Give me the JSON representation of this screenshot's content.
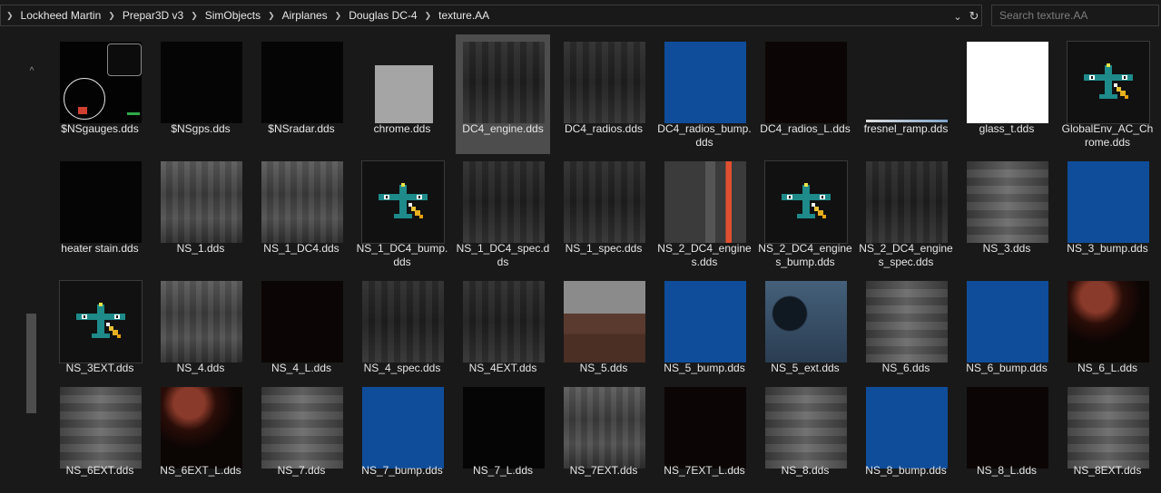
{
  "address": {
    "crumbs": [
      "Lockheed Martin",
      "Prepar3D v3",
      "SimObjects",
      "Airplanes",
      "Douglas DC-4",
      "texture.AA"
    ],
    "dropdown_icon": "chevron-down-icon",
    "refresh_icon": "refresh-icon"
  },
  "search": {
    "placeholder": "Search texture.AA"
  },
  "files": [
    {
      "name": "$NSgauges.dds",
      "style": "t-gauges"
    },
    {
      "name": "$NSgps.dds",
      "style": "t-black"
    },
    {
      "name": "$NSradar.dds",
      "style": "t-black"
    },
    {
      "name": "chrome.dds",
      "style": "t-gray"
    },
    {
      "name": "DC4_engine.dds",
      "style": "t-metal-dark",
      "selected": true
    },
    {
      "name": "DC4_radios.dds",
      "style": "t-metal-dark"
    },
    {
      "name": "DC4_radios_bump.dds",
      "style": "t-blue"
    },
    {
      "name": "DC4_radios_L.dds",
      "style": "t-dark"
    },
    {
      "name": "fresnel_ramp.dds",
      "style": "t-black"
    },
    {
      "name": "glass_t.dds",
      "style": "t-white"
    },
    {
      "name": "GlobalEnv_AC_Chrome.dds",
      "style": "plane"
    },
    {
      "name": "heater stain.dds",
      "style": "t-black"
    },
    {
      "name": "NS_1.dds",
      "style": "t-metal"
    },
    {
      "name": "NS_1_DC4.dds",
      "style": "t-metal"
    },
    {
      "name": "NS_1_DC4_bump.dds",
      "style": "plane"
    },
    {
      "name": "NS_1_DC4_spec.dds",
      "style": "t-metal-dark"
    },
    {
      "name": "NS_1_spec.dds",
      "style": "t-metal-dark"
    },
    {
      "name": "NS_2_DC4_engines.dds",
      "style": "t-engine"
    },
    {
      "name": "NS_2_DC4_engines_bump.dds",
      "style": "plane"
    },
    {
      "name": "NS_2_DC4_engines_spec.dds",
      "style": "t-metal-dark"
    },
    {
      "name": "NS_3.dds",
      "style": "t-metal2"
    },
    {
      "name": "NS_3_bump.dds",
      "style": "t-blue"
    },
    {
      "name": "NS_3EXT.dds",
      "style": "plane"
    },
    {
      "name": "NS_4.dds",
      "style": "t-metal"
    },
    {
      "name": "NS_4_L.dds",
      "style": "t-dark"
    },
    {
      "name": "NS_4_spec.dds",
      "style": "t-metal-dark"
    },
    {
      "name": "NS_4EXT.dds",
      "style": "t-metal-dark"
    },
    {
      "name": "NS_5.dds",
      "style": "t-brown"
    },
    {
      "name": "NS_5_bump.dds",
      "style": "t-blue"
    },
    {
      "name": "NS_5_ext.dds",
      "style": "t-bluish"
    },
    {
      "name": "NS_6.dds",
      "style": "t-metal2"
    },
    {
      "name": "NS_6_bump.dds",
      "style": "t-blue"
    },
    {
      "name": "NS_6_L.dds",
      "style": "t-glow"
    },
    {
      "name": "NS_6EXT.dds",
      "style": "t-metal2"
    },
    {
      "name": "NS_6EXT_L.dds",
      "style": "t-glow"
    },
    {
      "name": "NS_7.dds",
      "style": "t-metal2"
    },
    {
      "name": "NS_7_bump.dds",
      "style": "t-blue"
    },
    {
      "name": "NS_7_L.dds",
      "style": "t-black"
    },
    {
      "name": "NS_7EXT.dds",
      "style": "t-metal"
    },
    {
      "name": "NS_7EXT_L.dds",
      "style": "t-dark"
    },
    {
      "name": "NS_8.dds",
      "style": "t-metal2"
    },
    {
      "name": "NS_8_bump.dds",
      "style": "t-blue"
    },
    {
      "name": "NS_8_L.dds",
      "style": "t-dark"
    },
    {
      "name": "NS_8EXT.dds",
      "style": "t-metal2"
    }
  ]
}
